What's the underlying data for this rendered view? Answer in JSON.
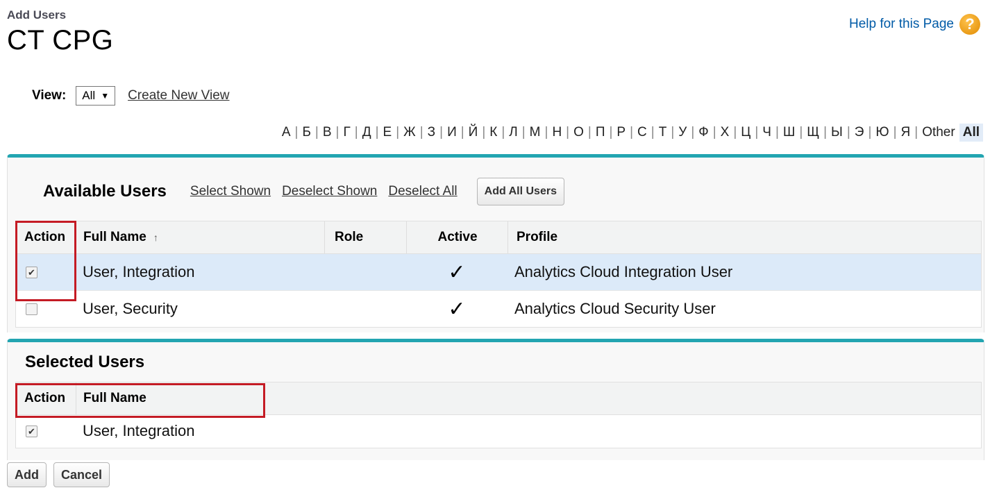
{
  "header": {
    "subtitle": "Add Users",
    "title": "CT CPG",
    "help_link": "Help for this Page",
    "help_icon": "question-mark-icon"
  },
  "view": {
    "label": "View:",
    "selected": "All",
    "create_link": "Create New View"
  },
  "alphabet": {
    "letters": [
      "А",
      "Б",
      "В",
      "Г",
      "Д",
      "Е",
      "Ж",
      "З",
      "И",
      "Й",
      "К",
      "Л",
      "М",
      "Н",
      "О",
      "П",
      "Р",
      "С",
      "Т",
      "У",
      "Ф",
      "Х",
      "Ц",
      "Ч",
      "Ш",
      "Щ",
      "Ы",
      "Э",
      "Ю",
      "Я",
      "Other"
    ],
    "active": "All"
  },
  "available": {
    "title": "Available Users",
    "select_shown": "Select Shown",
    "deselect_shown": "Deselect Shown",
    "deselect_all": "Deselect All",
    "add_all_button": "Add All Users",
    "columns": {
      "action": "Action",
      "full_name": "Full Name",
      "sort_indicator": "↑",
      "role": "Role",
      "active": "Active",
      "profile": "Profile"
    },
    "rows": [
      {
        "checked": true,
        "full_name": "User, Integration",
        "role": "",
        "active": "✓",
        "profile": "Analytics Cloud Integration User"
      },
      {
        "checked": false,
        "full_name": "User, Security",
        "role": "",
        "active": "✓",
        "profile": "Analytics Cloud Security User"
      }
    ]
  },
  "selected": {
    "title": "Selected Users",
    "columns": {
      "action": "Action",
      "full_name": "Full Name"
    },
    "rows": [
      {
        "checked": true,
        "full_name": "User, Integration"
      }
    ]
  },
  "buttons": {
    "add": "Add",
    "cancel": "Cancel"
  },
  "colors": {
    "panel_accent": "#23a5b1",
    "highlight_box": "#c41b24",
    "row_highlight": "#dceaf9",
    "link": "#015ba7"
  }
}
